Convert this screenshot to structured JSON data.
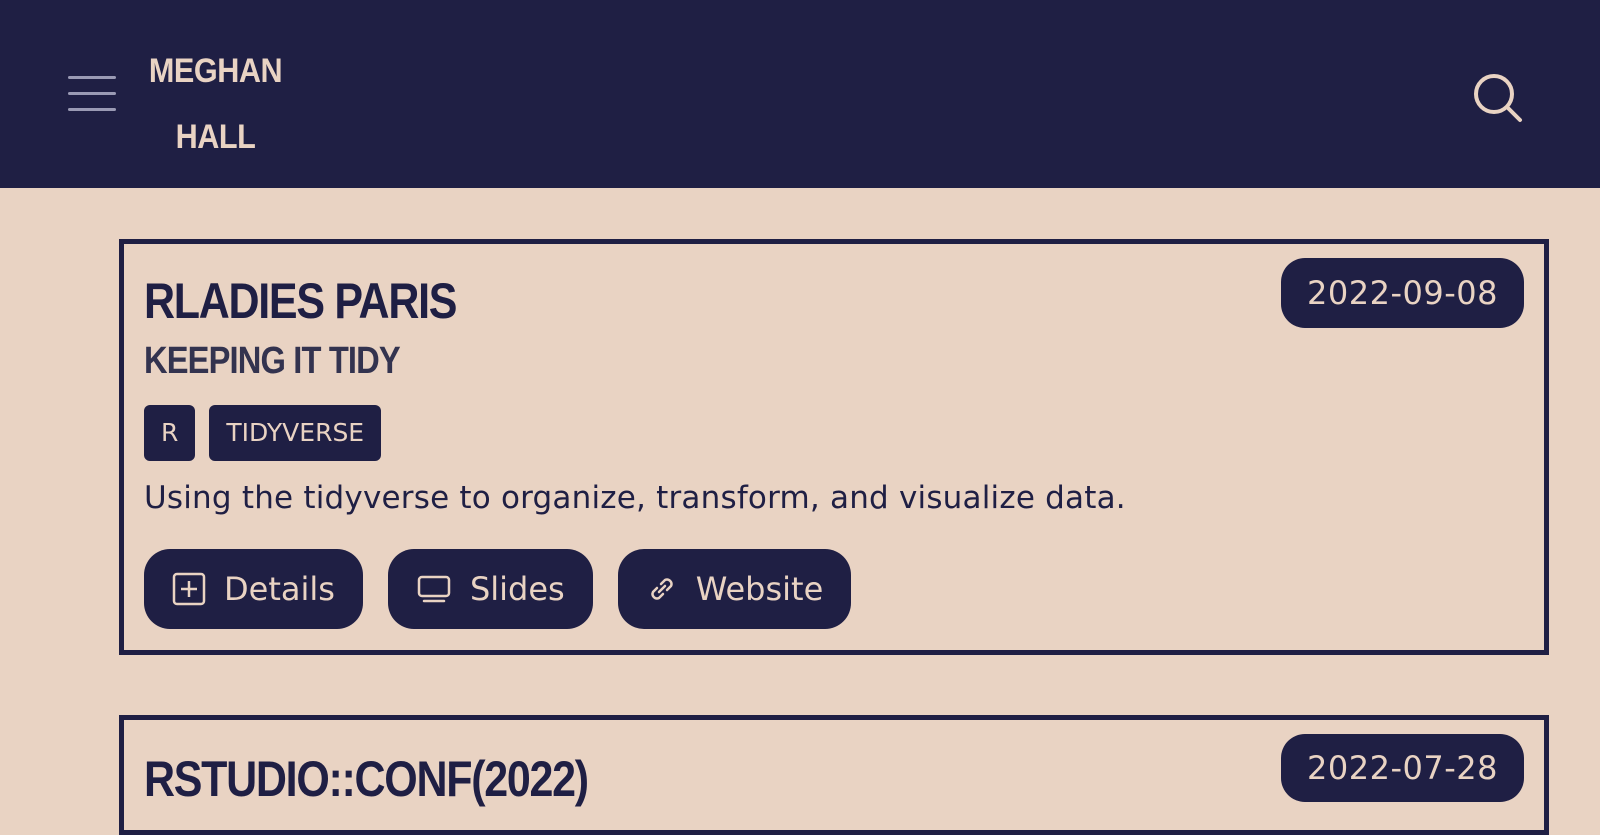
{
  "header": {
    "brand_line1": "MEGHAN",
    "brand_line2": "HALL",
    "menu_icon": "hamburger-menu-icon",
    "search_icon": "search-icon",
    "background": "#1f1f44",
    "text_color": "#e9d3c3"
  },
  "talks": [
    {
      "title": "RLADIES PARIS",
      "subtitle": "KEEPING IT TIDY",
      "date": "2022-09-08",
      "tags": [
        "R",
        "TIDYVERSE"
      ],
      "description": "Using the tidyverse to organize, transform, and visualize data.",
      "actions": [
        {
          "label": "Details",
          "icon": "plus-square-icon"
        },
        {
          "label": "Slides",
          "icon": "laptop-icon"
        },
        {
          "label": "Website",
          "icon": "link-icon"
        }
      ]
    },
    {
      "title": "RSTUDIO::CONF(2022)",
      "date": "2022-07-28"
    }
  ],
  "theme": {
    "page_background": "#e9d3c3",
    "accent": "#1f1f44"
  }
}
